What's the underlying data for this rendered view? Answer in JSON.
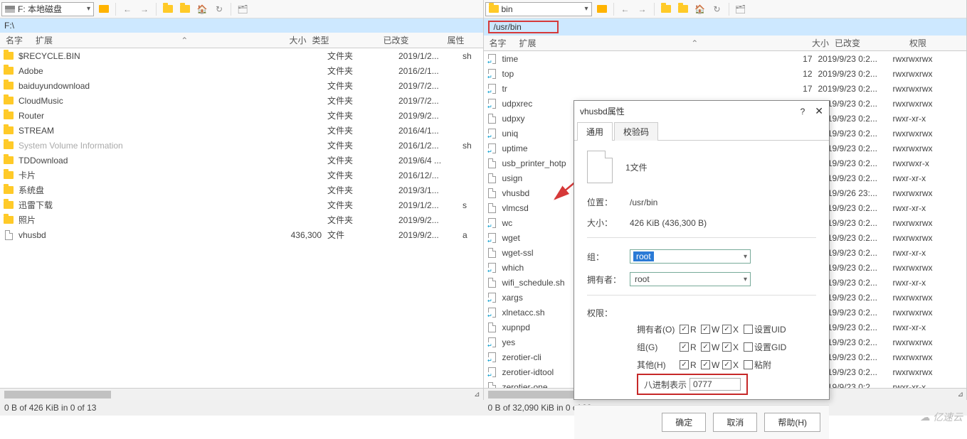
{
  "left": {
    "drive_label": "F: 本地磁盘",
    "path": "F:\\",
    "columns": {
      "name": "名字",
      "ext": "扩展",
      "sort": "⌃",
      "size": "大小",
      "type": "类型",
      "date": "已改变",
      "attr": "属性"
    },
    "rows": [
      {
        "name": "$RECYCLE.BIN",
        "size": "",
        "type": "文件夹",
        "date": "2019/1/2...",
        "attr": "sh",
        "icon": "folder"
      },
      {
        "name": "Adobe",
        "size": "",
        "type": "文件夹",
        "date": "2016/2/1...",
        "attr": "",
        "icon": "folder"
      },
      {
        "name": "baiduyundownload",
        "size": "",
        "type": "文件夹",
        "date": "2019/7/2...",
        "attr": "",
        "icon": "folder"
      },
      {
        "name": "CloudMusic",
        "size": "",
        "type": "文件夹",
        "date": "2019/7/2...",
        "attr": "",
        "icon": "folder"
      },
      {
        "name": "Router",
        "size": "",
        "type": "文件夹",
        "date": "2019/9/2...",
        "attr": "",
        "icon": "folder"
      },
      {
        "name": "STREAM",
        "size": "",
        "type": "文件夹",
        "date": "2016/4/1...",
        "attr": "",
        "icon": "folder"
      },
      {
        "name": "System Volume Information",
        "size": "",
        "type": "文件夹",
        "date": "2016/1/2...",
        "attr": "sh",
        "icon": "folder",
        "gray": true
      },
      {
        "name": "TDDownload",
        "size": "",
        "type": "文件夹",
        "date": "2019/6/4 ...",
        "attr": "",
        "icon": "folder"
      },
      {
        "name": "卡片",
        "size": "",
        "type": "文件夹",
        "date": "2016/12/...",
        "attr": "",
        "icon": "folder"
      },
      {
        "name": "系统盘",
        "size": "",
        "type": "文件夹",
        "date": "2019/3/1...",
        "attr": "",
        "icon": "folder"
      },
      {
        "name": "迅雷下载",
        "size": "",
        "type": "文件夹",
        "date": "2019/1/2...",
        "attr": "s",
        "icon": "folder"
      },
      {
        "name": "照片",
        "size": "",
        "type": "文件夹",
        "date": "2019/9/2...",
        "attr": "",
        "icon": "folder"
      },
      {
        "name": "vhusbd",
        "size": "436,300",
        "type": "文件",
        "date": "2019/9/2...",
        "attr": "a",
        "icon": "file"
      }
    ],
    "status": "0 B of 426 KiB in 0 of 13"
  },
  "right": {
    "drive_label": "bin",
    "path": "/usr/bin",
    "columns": {
      "name": "名字",
      "ext": "扩展",
      "sort": "⌃",
      "size": "大小",
      "date": "已改变",
      "perm": "权限"
    },
    "rows": [
      {
        "name": "time",
        "size": "17",
        "date": "2019/9/23 0:2...",
        "perm": "rwxrwxrwx",
        "icon": "link"
      },
      {
        "name": "top",
        "size": "12",
        "date": "2019/9/23 0:2...",
        "perm": "rwxrwxrwx",
        "icon": "link"
      },
      {
        "name": "tr",
        "size": "17",
        "date": "2019/9/23 0:2...",
        "perm": "rwxrwxrwx",
        "icon": "link"
      },
      {
        "name": "udpxrec",
        "size": "",
        "date": "2019/9/23 0:2...",
        "perm": "rwxrwxrwx",
        "icon": "link"
      },
      {
        "name": "udpxy",
        "size": "",
        "date": "2019/9/23 0:2...",
        "perm": "rwxr-xr-x",
        "icon": "file"
      },
      {
        "name": "uniq",
        "size": "",
        "date": "2019/9/23 0:2...",
        "perm": "rwxrwxrwx",
        "icon": "link"
      },
      {
        "name": "uptime",
        "size": "",
        "date": "2019/9/23 0:2...",
        "perm": "rwxrwxrwx",
        "icon": "link"
      },
      {
        "name": "usb_printer_hotp",
        "size": "",
        "date": "2019/9/23 0:2...",
        "perm": "rwxrwxr-x",
        "icon": "file"
      },
      {
        "name": "usign",
        "size": "",
        "date": "2019/9/23 0:2...",
        "perm": "rwxr-xr-x",
        "icon": "file"
      },
      {
        "name": "vhusbd",
        "size": "",
        "date": "2019/9/26 23:...",
        "perm": "rwxrwxrwx",
        "icon": "file"
      },
      {
        "name": "vlmcsd",
        "size": "",
        "date": "2019/9/23 0:2...",
        "perm": "rwxr-xr-x",
        "icon": "file"
      },
      {
        "name": "wc",
        "size": "",
        "date": "2019/9/23 0:2...",
        "perm": "rwxrwxrwx",
        "icon": "link"
      },
      {
        "name": "wget",
        "size": "",
        "date": "2019/9/23 0:2...",
        "perm": "rwxrwxrwx",
        "icon": "link"
      },
      {
        "name": "wget-ssl",
        "size": "",
        "date": "2019/9/23 0:2...",
        "perm": "rwxr-xr-x",
        "icon": "file"
      },
      {
        "name": "which",
        "size": "",
        "date": "2019/9/23 0:2...",
        "perm": "rwxrwxrwx",
        "icon": "link"
      },
      {
        "name": "wifi_schedule.sh",
        "size": "",
        "date": "2019/9/23 0:2...",
        "perm": "rwxr-xr-x",
        "icon": "file"
      },
      {
        "name": "xargs",
        "size": "",
        "date": "2019/9/23 0:2...",
        "perm": "rwxrwxrwx",
        "icon": "link"
      },
      {
        "name": "xlnetacc.sh",
        "size": "",
        "date": "2019/9/23 0:2...",
        "perm": "rwxrwxrwx",
        "icon": "link"
      },
      {
        "name": "xupnpd",
        "size": "",
        "date": "2019/9/23 0:2...",
        "perm": "rwxr-xr-x",
        "icon": "file"
      },
      {
        "name": "yes",
        "size": "",
        "date": "2019/9/23 0:2...",
        "perm": "rwxrwxrwx",
        "icon": "link"
      },
      {
        "name": "zerotier-cli",
        "size": "",
        "date": "2019/9/23 0:2...",
        "perm": "rwxrwxrwx",
        "icon": "link"
      },
      {
        "name": "zerotier-idtool",
        "size": "",
        "date": "2019/9/23 0:2...",
        "perm": "rwxrwxrwx",
        "icon": "link"
      },
      {
        "name": "zerotier-one",
        "size": "",
        "date": "2019/9/23 0:2...",
        "perm": "rwxr-xr-x",
        "icon": "file"
      }
    ],
    "status": "0 B of 32,090 KiB in 0 of 99"
  },
  "dialog": {
    "title": "vhusbd属性",
    "tab_general": "通用",
    "tab_checksum": "校验码",
    "file_count": "1文件",
    "loc_label": "位置：",
    "loc_val": "/usr/bin",
    "size_label": "大小：",
    "size_val": "426 KiB (436,300 B)",
    "group_label": "组：",
    "group_val": "root",
    "owner_label": "拥有者：",
    "owner_val": "root",
    "perm_label": "权限：",
    "col_owner": "拥有者(O)",
    "col_group": "组(G)",
    "col_other": "其他(H)",
    "set_uid": "设置UID",
    "set_gid": "设置GID",
    "sticky": "粘附",
    "oct_label": "八进制表示",
    "oct_val": "0777",
    "ok": "确定",
    "cancel": "取消",
    "help": "帮助(H)"
  },
  "watermark": "亿速云"
}
